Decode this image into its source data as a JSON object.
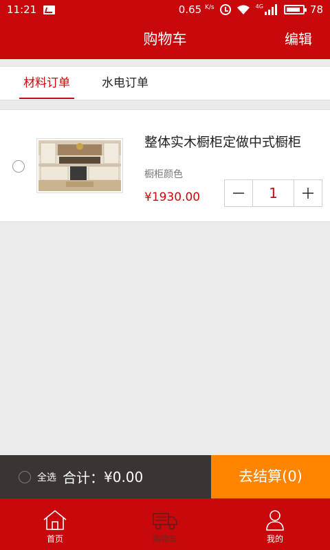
{
  "status_bar": {
    "time": "11:21",
    "speed": "0.65",
    "speed_unit": "K/s",
    "network": "4G",
    "battery": "78"
  },
  "header": {
    "title": "购物车",
    "edit_label": "编辑"
  },
  "tabs": [
    {
      "label": "材料订单",
      "active": true
    },
    {
      "label": "水电订单",
      "active": false
    }
  ],
  "cart_items": [
    {
      "name": "整体实木橱柜定做中式橱柜",
      "spec": "橱柜颜色",
      "price": "¥1930.00",
      "quantity": "1",
      "selected": false,
      "image": "kitchen-cabinet-photo"
    }
  ],
  "checkout": {
    "select_all_label": "全选",
    "total_label": "合计：",
    "total_value": "¥0.00",
    "button_label": "去结算(0)"
  },
  "bottom_nav": [
    {
      "label": "首页",
      "icon": "home-icon",
      "active": false
    },
    {
      "label": "购物车",
      "icon": "truck-icon",
      "active": true
    },
    {
      "label": "我的",
      "icon": "user-icon",
      "active": false
    }
  ],
  "colors": {
    "brand_red": "#c8080b",
    "checkout_orange": "#ff8400",
    "checkout_dark": "#3a3532",
    "background": "#ebebeb"
  }
}
